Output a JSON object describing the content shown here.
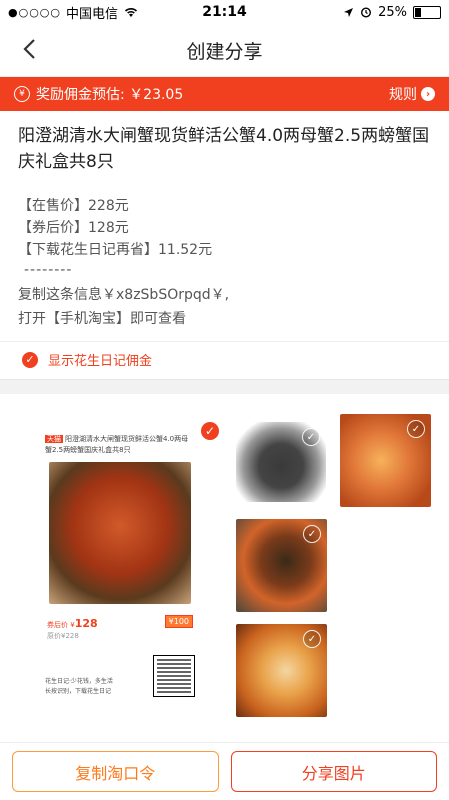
{
  "status_bar": {
    "signal": "●○○○○",
    "carrier": "中国电信",
    "time": "21:14",
    "battery_text": "25%",
    "battery_level": 0.25
  },
  "nav": {
    "title": "创建分享"
  },
  "reward_bar": {
    "text": "奖励佣金预估: ￥23.05",
    "rules_label": "规则"
  },
  "product": {
    "title": "阳澄湖清水大闸蟹现货鲜活公蟹4.0两母蟹2.5两螃蟹国庆礼盒共8只",
    "on_sale_price": "【在售价】228元",
    "after_coupon_price": "【券后价】128元",
    "app_saving": "【下载花生日记再省】11.52元",
    "divider": "--------",
    "copy_line1": "复制这条信息￥x8zSbSOrpqd￥,",
    "copy_line2": "打开【手机淘宝】即可查看"
  },
  "show_commission": {
    "label": "显示花生日记佣金",
    "checked": true
  },
  "poster": {
    "tag": "天猫",
    "head_text": "阳澄湖清水大闸蟹现货鲜活公蟹4.0两母蟹2.5两螃蟹国庆礼盒共8只",
    "price_label": "券后价 ¥",
    "price": "128",
    "coupon": "¥100",
    "orig_price": "原价¥228",
    "foot_line1": "花生日记·少花钱，多生活",
    "foot_line2": "长按识别，下载花生日记"
  },
  "thumbnails": [
    {
      "name": "crabs-bowl",
      "color": "#8a8a8a"
    },
    {
      "name": "crab-roe-1",
      "color": "#e2793a"
    },
    {
      "name": "crab-steamed",
      "color": "#b0522a"
    },
    {
      "name": "crab-roe-2",
      "color": "#d9822b"
    }
  ],
  "bottom": {
    "copy_button": "复制淘口令",
    "share_button": "分享图片"
  },
  "colors": {
    "accent": "#f0401f",
    "orange": "#ff7a1a"
  }
}
